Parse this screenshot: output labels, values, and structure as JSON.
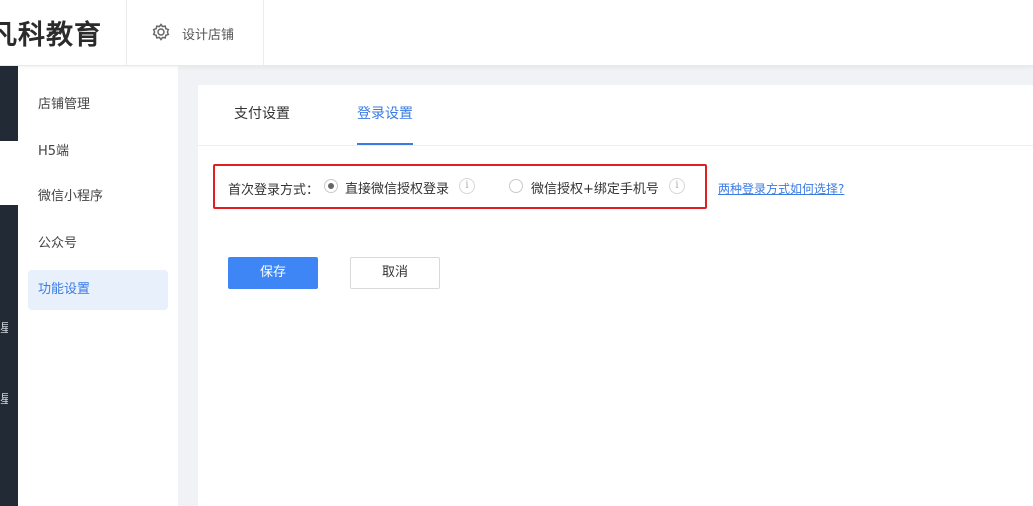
{
  "header": {
    "brand": "凡科教育",
    "design_shop": "设计店铺",
    "design_shop_icon": "gear-icon"
  },
  "dark_rail": {
    "chars": [
      "星",
      "星"
    ]
  },
  "sidebar": {
    "items": [
      {
        "label": "店铺管理"
      },
      {
        "label": "H5端"
      },
      {
        "label": "微信小程序"
      },
      {
        "label": "公众号"
      },
      {
        "label": "功能设置",
        "active": true
      }
    ]
  },
  "tabs": [
    {
      "label": "支付设置"
    },
    {
      "label": "登录设置",
      "active": true
    }
  ],
  "login": {
    "label": "首次登录方式：",
    "options": [
      {
        "label": "直接微信授权登录",
        "selected": true
      },
      {
        "label": "微信授权+绑定手机号",
        "selected": false
      }
    ],
    "info_glyph": "i",
    "help_link": "两种登录方式如何选择?"
  },
  "actions": {
    "save": "保存",
    "cancel": "取消"
  },
  "colors": {
    "accent": "#3e86f5",
    "highlight_border": "#e02020",
    "dark_rail": "#222a35"
  }
}
